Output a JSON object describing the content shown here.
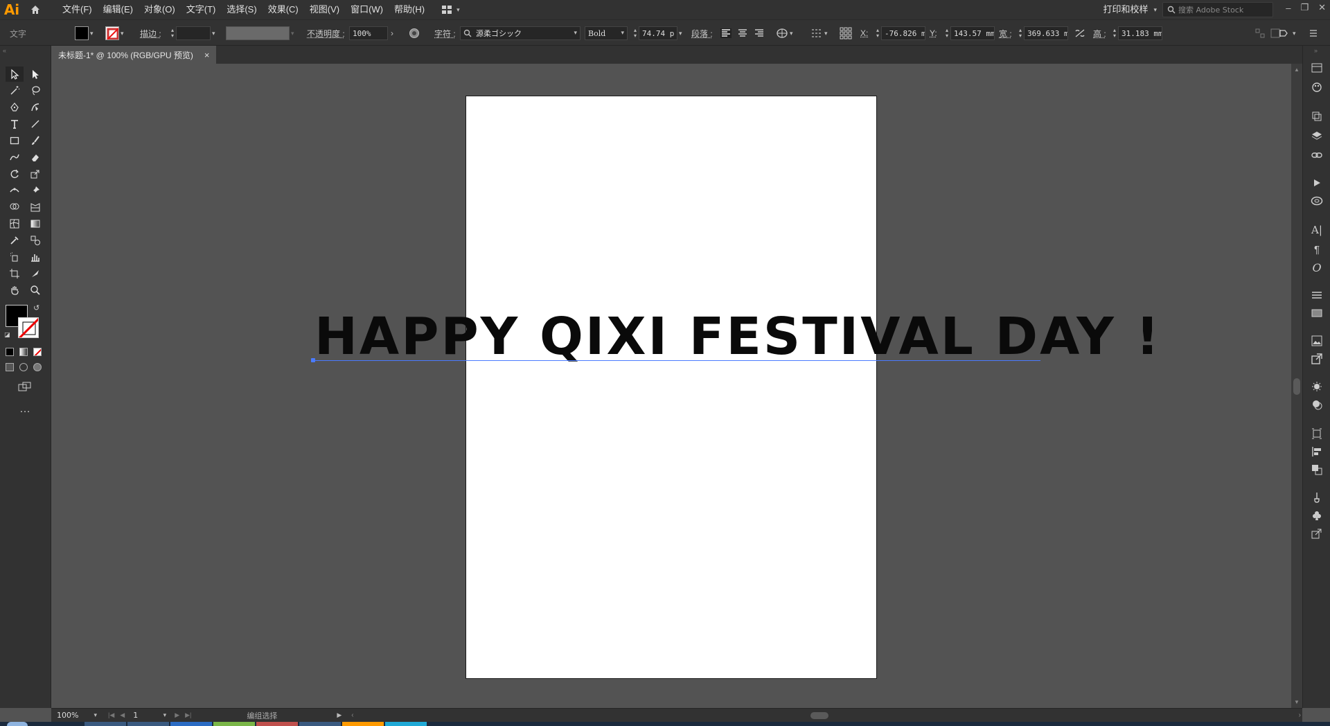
{
  "app": {
    "logo": "Ai",
    "menu": [
      "文件(F)",
      "编辑(E)",
      "对象(O)",
      "文字(T)",
      "选择(S)",
      "效果(C)",
      "视图(V)",
      "窗口(W)",
      "帮助(H)"
    ],
    "workspace": "打印和校样",
    "stock_search_placeholder": "搜索 Adobe Stock"
  },
  "control_bar": {
    "mode_label": "文字",
    "stroke_label": "描边 :",
    "opacity_label": "不透明度 :",
    "opacity_value": "100%",
    "character_label": "字符 :",
    "font_family": "源柔ゴシック",
    "font_style": "Bold",
    "font_size": "74.74 p",
    "paragraph_label": "段落 :",
    "x_label": "X:",
    "x_value": "-76.826 m",
    "y_label": "Y:",
    "y_value": "143.57 mm",
    "w_label": "宽 :",
    "w_value": "369.633 m",
    "h_label": "高 :",
    "h_value": "31.183 mm",
    "fill_color": "#000000"
  },
  "document": {
    "tab_title": "未标题-1* @ 100% (RGB/GPU 预览)",
    "close": "×",
    "artwork_text": "HAPPY QIXI FESTIVAL DAY !"
  },
  "status": {
    "zoom": "100%",
    "page": "1",
    "mode": "编组选择"
  },
  "colors": {
    "ui_dark": "#323232",
    "canvas": "#535353",
    "selection": "#4a7bff",
    "logo": "#ff9a00"
  }
}
